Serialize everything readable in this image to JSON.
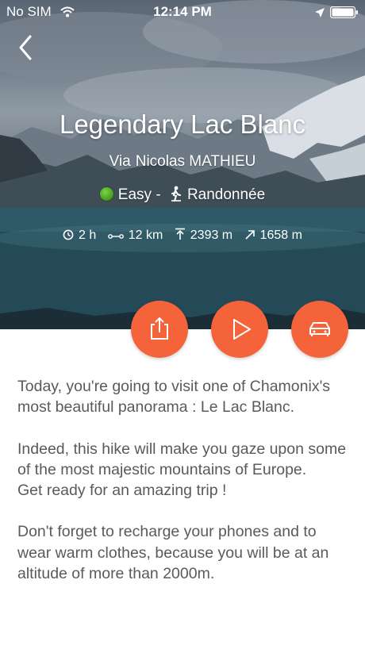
{
  "status_bar": {
    "carrier": "No SIM",
    "time": "12:14 PM",
    "icons": [
      "wifi-icon",
      "location-arrow-icon",
      "battery-icon"
    ]
  },
  "header": {
    "back_icon": "chevron-left-icon"
  },
  "hike": {
    "title": "Legendary Lac Blanc",
    "via_label": "Via",
    "author": "Nicolas MATHIEU",
    "difficulty": "Easy -",
    "difficulty_color": "#4aa51f",
    "activity": "Randonnée",
    "stats": {
      "duration": "2 h",
      "distance": "12 km",
      "max_altitude": "2393 m",
      "elevation_gain": "1658 m"
    }
  },
  "actions": {
    "accent_color": "#f4633a",
    "buttons": [
      "share-button",
      "play-button",
      "car-button"
    ]
  },
  "description": {
    "paragraphs": [
      "Today, you're going to visit one of Chamonix's most beautiful panorama : Le Lac Blanc.",
      "Indeed, this hike will make you gaze upon some of the most majestic mountains of Europe.\nGet ready for an amazing trip !",
      "Don't forget to recharge your phones and to wear warm clothes, because you will be at an altitude of more than 2000m."
    ]
  }
}
